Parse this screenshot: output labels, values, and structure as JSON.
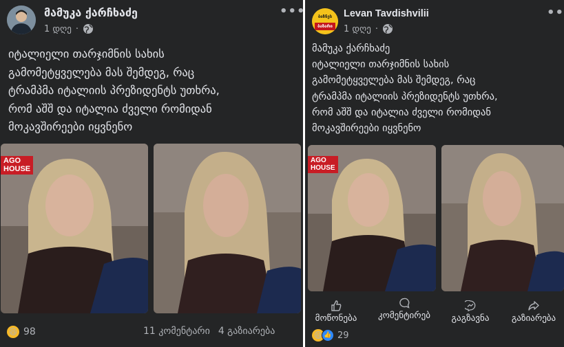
{
  "left_post": {
    "author": "მამუკა ქარჩხაძე",
    "time": "1 დღე",
    "text": "იტალიელი თარჯიმნის სახის\nგამომეტყველება მას შემდეგ, რაც\nტრამპმა იტალიის პრეზიდენტს უთხრა,\nრომ აშშ და იტალია ძველი რომიდან\nმოკავშირეები იყვნენო",
    "banner_text": "AGO\nHOUSE",
    "reactions_count": "98",
    "comments": "11 კომენტარი",
    "shares": "4 გაზიარება"
  },
  "right_post": {
    "author": "Levan Tavdishvilii",
    "avatar_text_top": "ბიზნეს",
    "avatar_text_bottom": "ბაზარი",
    "time": "1 დღე",
    "text": "მამუკა ქარჩხაძე\nიტალიელი თარჯიმნის სახის\nგამომეტყველება მას შემდეგ, რაც\nტრამპმა იტალიის პრეზიდენტს უთხრა,\nრომ აშშ და იტალია ძველი რომიდან\nმოკავშირეები იყვნენო",
    "banner_text": "AGO\nHOUSE",
    "actions": {
      "like": "მოწონება",
      "comment": "კომენტირებ",
      "send": "გაგზავნა",
      "share": "გაზიარება"
    },
    "reactions_count": "29"
  },
  "icons": {
    "privacy": "globe-icon",
    "more": "more-dots-icon",
    "like": "thumbs-up-icon",
    "comment": "comment-bubble-icon",
    "send": "messenger-icon",
    "share": "share-arrow-icon",
    "haha": "laughing-emoji-icon"
  },
  "colors": {
    "panel_bg": "#242526",
    "text": "#e4e6eb",
    "muted": "#b0b3b8",
    "like_blue": "#2e89ff",
    "banner_red": "#c81d25"
  }
}
